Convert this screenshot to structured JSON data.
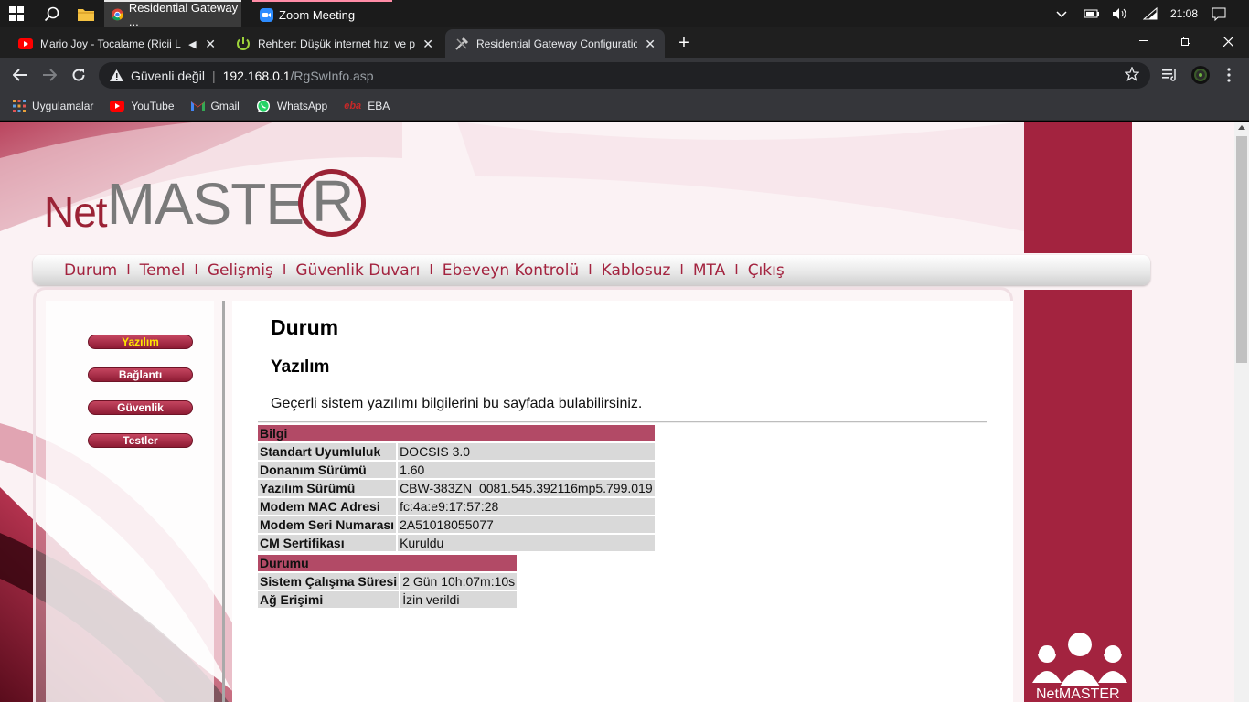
{
  "taskbar": {
    "apps": [
      {
        "title": "Residential Gateway ..."
      },
      {
        "title": "Zoom Meeting"
      }
    ],
    "clock": "21:08"
  },
  "tabs": [
    {
      "title": "Mario Joy - Tocalame (Ricii Le"
    },
    {
      "title": "Rehber: Düşük internet hızı ve pi"
    },
    {
      "title": "Residential Gateway Configuratio"
    }
  ],
  "omnibox": {
    "security": "Güvenli değil",
    "host": "192.168.0.1",
    "path": "/RgSwInfo.asp"
  },
  "bookmarks": [
    {
      "label": "Uygulamalar",
      "icon": "apps-grid-icon"
    },
    {
      "label": "YouTube",
      "icon": "youtube-icon"
    },
    {
      "label": "Gmail",
      "icon": "gmail-icon"
    },
    {
      "label": "WhatsApp",
      "icon": "whatsapp-icon"
    },
    {
      "label": "EBA",
      "icon": "eba-icon"
    }
  ],
  "logo": {
    "net": "Net",
    "master": "MASTE",
    "r": "R"
  },
  "menu": [
    "Durum",
    "Temel",
    "Gelişmiş",
    "Güvenlik Duvarı",
    "Ebeveyn Kontrolü",
    "Kablosuz",
    "MTA",
    "Çıkış"
  ],
  "sidenav": [
    "Yazılım",
    "Bağlantı",
    "Güvenlik",
    "Testler"
  ],
  "content": {
    "title": "Durum",
    "subtitle": "Yazılım",
    "description": "Geçerli sistem yazılımı bilgilerini bu sayfada bulabilirsiniz."
  },
  "info_table": {
    "header": "Bilgi",
    "rows": [
      {
        "k": "Standart Uyumluluk",
        "v": "DOCSIS 3.0"
      },
      {
        "k": "Donanım Sürümü",
        "v": "1.60"
      },
      {
        "k": "Yazılım Sürümü",
        "v": "CBW-383ZN_0081.545.392116mp5.799.019"
      },
      {
        "k": "Modem MAC Adresi",
        "v": "fc:4a:e9:17:57:28"
      },
      {
        "k": "Modem Seri Numarası",
        "v": "2A51018055077"
      },
      {
        "k": "CM Sertifikası",
        "v": "Kuruldu"
      }
    ]
  },
  "status_table": {
    "header": "Durumu",
    "rows": [
      {
        "k": "Sistem Çalışma Süresi",
        "v": "2 Gün 10h:07m:10s"
      },
      {
        "k": "Ağ Erişimi",
        "v": "İzin verildi"
      }
    ]
  },
  "brand_footer": "NetMASTER",
  "colors": {
    "brand_red": "#a3233f",
    "table_header": "#b24a66",
    "table_cell": "#d9d9d9"
  }
}
